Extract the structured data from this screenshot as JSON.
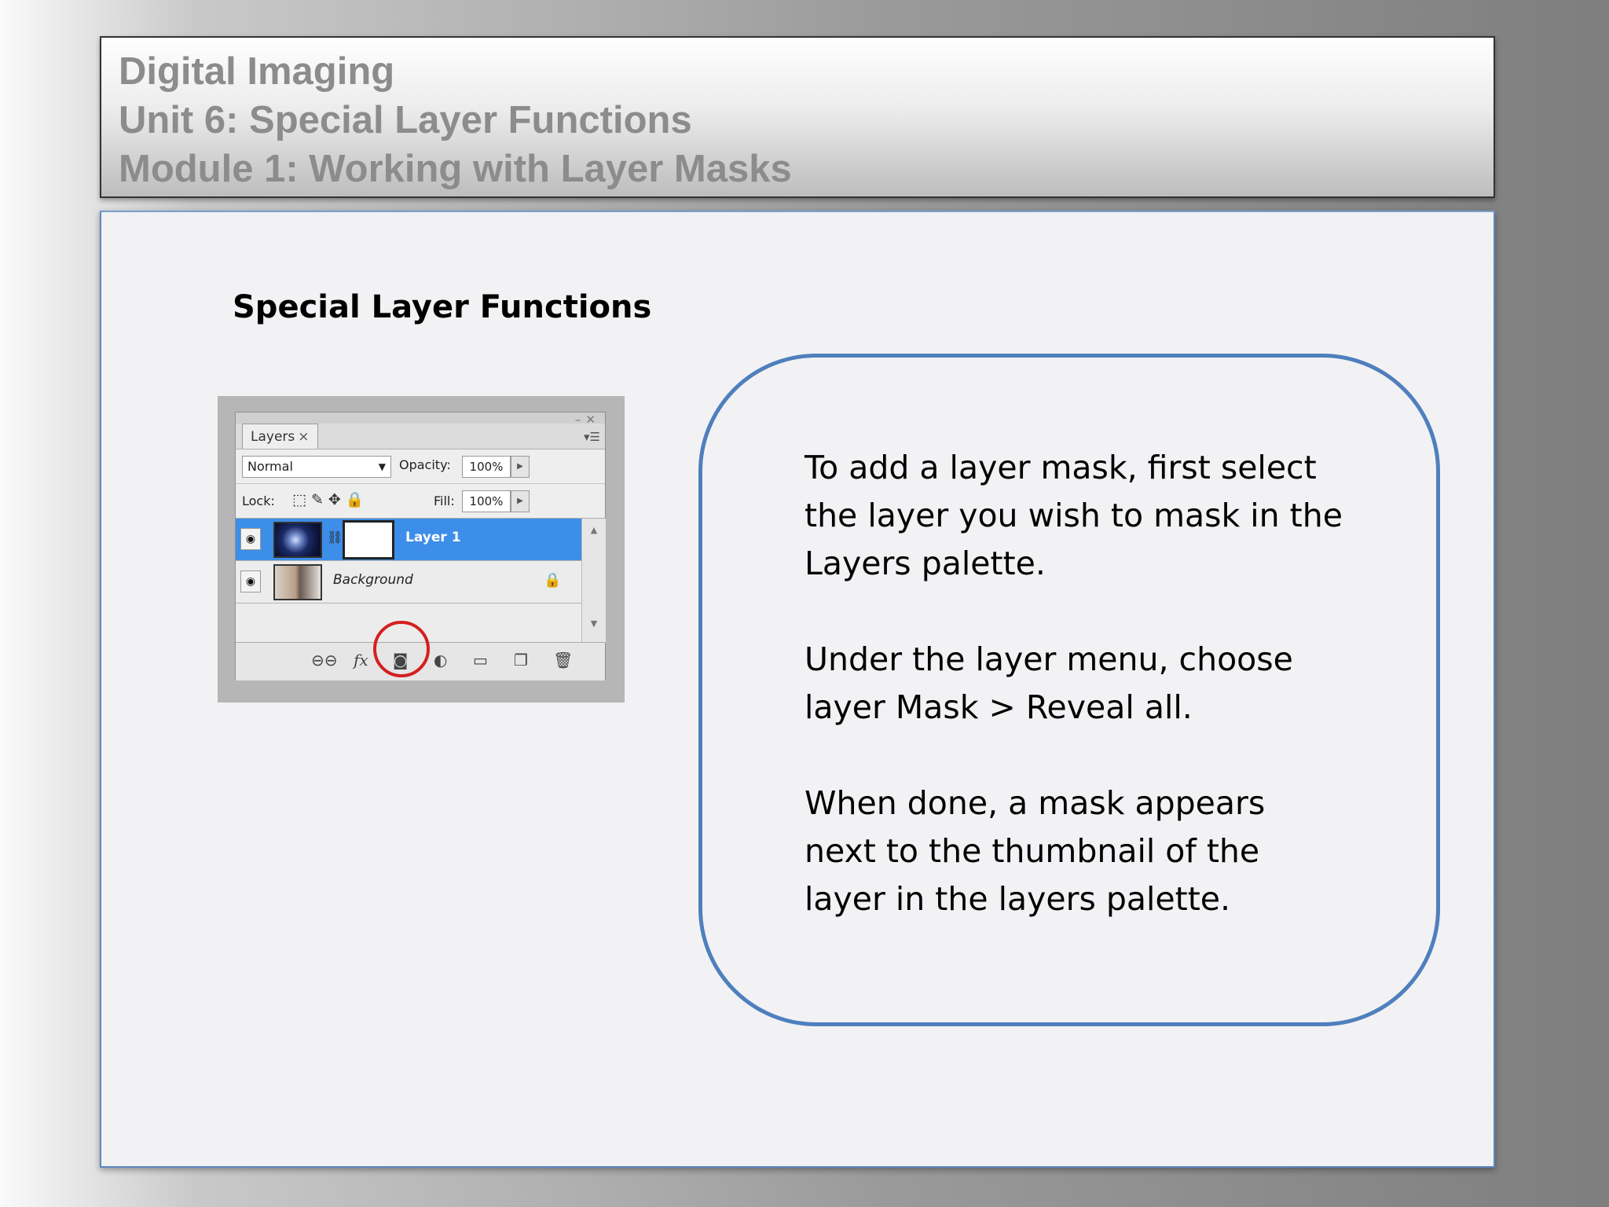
{
  "header": {
    "line1": "Digital Imaging",
    "line2": "Unit 6: Special Layer Functions",
    "line3": "Module 1: Working with Layer Masks"
  },
  "slide": {
    "title": "Special Layer Functions"
  },
  "layers_palette": {
    "tab_label": "Layers",
    "tab_close": "×",
    "blend_mode": "Normal",
    "opacity_label": "Opacity:",
    "opacity_value": "100%",
    "lock_label": "Lock:",
    "fill_label": "Fill:",
    "fill_value": "100%",
    "layers": [
      {
        "name": "Layer 1",
        "selected": true
      },
      {
        "name": "Background",
        "selected": false
      }
    ],
    "bottom_icons": [
      "link-icon",
      "fx-icon",
      "add-mask-icon",
      "adjustment-icon",
      "folder-icon",
      "new-layer-icon",
      "trash-icon"
    ],
    "highlight_color": "#d42020",
    "selection_color": "#3d8ee8"
  },
  "callout": {
    "paragraph1": "To add a layer mask, first select\nthe layer you wish to mask in the\nLayers palette.",
    "paragraph2": "Under the layer menu, choose\nlayer Mask > Reveal all.",
    "paragraph3": "When done, a mask appears\nnext to the thumbnail of the\nlayer in the layers palette.",
    "border_color": "#4f7fbd"
  }
}
